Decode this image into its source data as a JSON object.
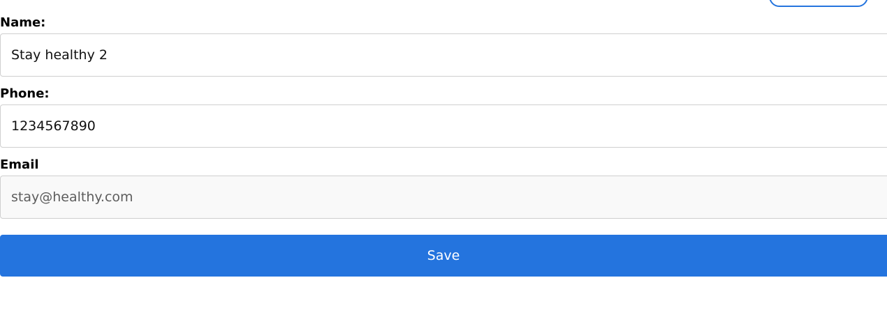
{
  "form": {
    "name": {
      "label": "Name:",
      "value": "Stay healthy 2"
    },
    "phone": {
      "label": "Phone:",
      "value": "1234567890"
    },
    "email": {
      "label": "Email",
      "value": "stay@healthy.com"
    },
    "save_label": "Save"
  },
  "colors": {
    "accent": "#2474de",
    "input_border": "#cfcfcf",
    "readonly_background": "#f9f9f9"
  }
}
